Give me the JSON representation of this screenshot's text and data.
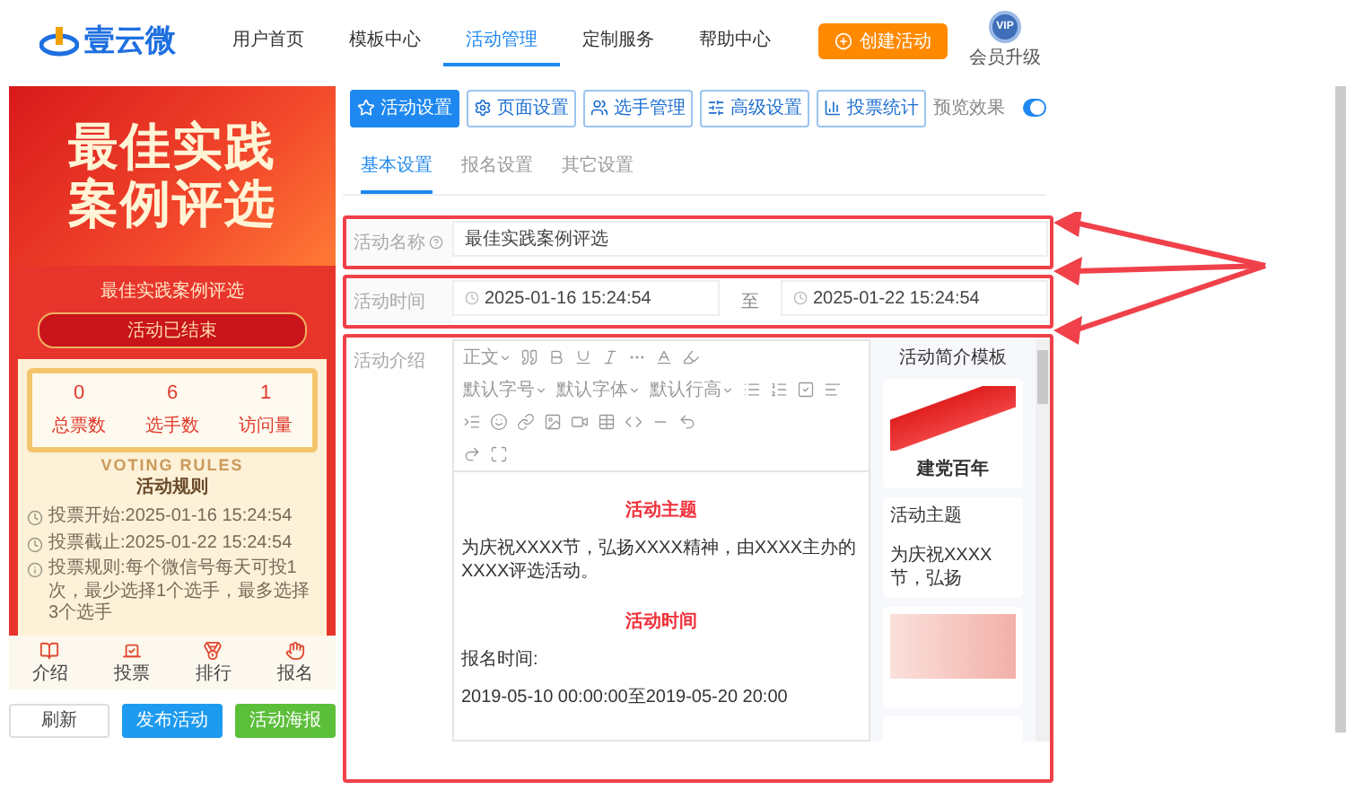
{
  "header": {
    "logo": "壹云微",
    "nav": [
      {
        "label": "用户首页",
        "selected": false
      },
      {
        "label": "模板中心",
        "selected": false
      },
      {
        "label": "活动管理",
        "selected": true
      },
      {
        "label": "定制服务",
        "selected": false
      },
      {
        "label": "帮助中心",
        "selected": false
      }
    ],
    "create_button": "创建活动",
    "vip_badge": "VIP",
    "vip_label": "会员升级"
  },
  "preview": {
    "banner_title": [
      "最佳实践",
      "案例评选"
    ],
    "title": "最佳实践案例评选",
    "status": "活动已结束",
    "stats": [
      {
        "value": "0",
        "label": "总票数"
      },
      {
        "value": "6",
        "label": "选手数"
      },
      {
        "value": "1",
        "label": "访问量"
      }
    ],
    "rules_backdrop": "VOTING RULES",
    "rules_title": "活动规则",
    "rules": [
      {
        "kind": "clock",
        "label": "投票开始:",
        "text": "2025-01-16 15:24:54"
      },
      {
        "kind": "clock",
        "label": "投票截止:",
        "text": "2025-01-22 15:24:54"
      },
      {
        "kind": "info",
        "label": "投票规则:",
        "text": "每个微信号每天可投1次，最少选择1个选手，最多选择3个选手"
      }
    ],
    "nav": [
      {
        "label": "介绍"
      },
      {
        "label": "投票"
      },
      {
        "label": "排行"
      },
      {
        "label": "报名"
      }
    ]
  },
  "preview_buttons": [
    {
      "label": "刷新",
      "kind": "plain"
    },
    {
      "label": "发布活动",
      "kind": "primary"
    },
    {
      "label": "活动海报",
      "kind": "success"
    }
  ],
  "toolbar": {
    "buttons": [
      {
        "label": "活动设置",
        "selected": true
      },
      {
        "label": "页面设置",
        "selected": false
      },
      {
        "label": "选手管理",
        "selected": false
      },
      {
        "label": "高级设置",
        "selected": false
      },
      {
        "label": "投票统计",
        "selected": false
      }
    ],
    "preview_label": "预览效果",
    "preview_on": true
  },
  "sub_tabs": [
    {
      "label": "基本设置",
      "selected": true
    },
    {
      "label": "报名设置",
      "selected": false
    },
    {
      "label": "其它设置",
      "selected": false
    }
  ],
  "form": {
    "name": {
      "label": "活动名称",
      "value": "最佳实践案例评选",
      "highlighted": true
    },
    "time": {
      "label": "活动时间",
      "start": "2025-01-16 15:24:54",
      "separator": "至",
      "end": "2025-01-22 15:24:54",
      "highlighted": true
    },
    "intro": {
      "label": "活动介绍",
      "highlighted": true,
      "editor_dropdowns": [
        "正文",
        "默认字号",
        "默认字体",
        "默认行高"
      ],
      "content": [
        {
          "kind": "heading",
          "text": "活动主题"
        },
        {
          "kind": "paragraph",
          "text": "为庆祝XXXX节，弘扬XXXX精神，由XXXX主办的XXXX评选活动。"
        },
        {
          "kind": "heading",
          "text": "活动时间"
        },
        {
          "kind": "paragraph",
          "text": "报名时间:"
        },
        {
          "kind": "paragraph",
          "text": "2019-05-10 00:00:00至2019-05-20 20:00"
        }
      ],
      "templates_title": "活动简介模板",
      "templates": [
        {
          "kind": "flag",
          "caption": "建党百年"
        },
        {
          "kind": "text",
          "title": "活动主题",
          "excerpt": "为庆祝XXXX节，弘扬"
        },
        {
          "kind": "pastel"
        },
        {
          "kind": "blank"
        }
      ]
    }
  }
}
